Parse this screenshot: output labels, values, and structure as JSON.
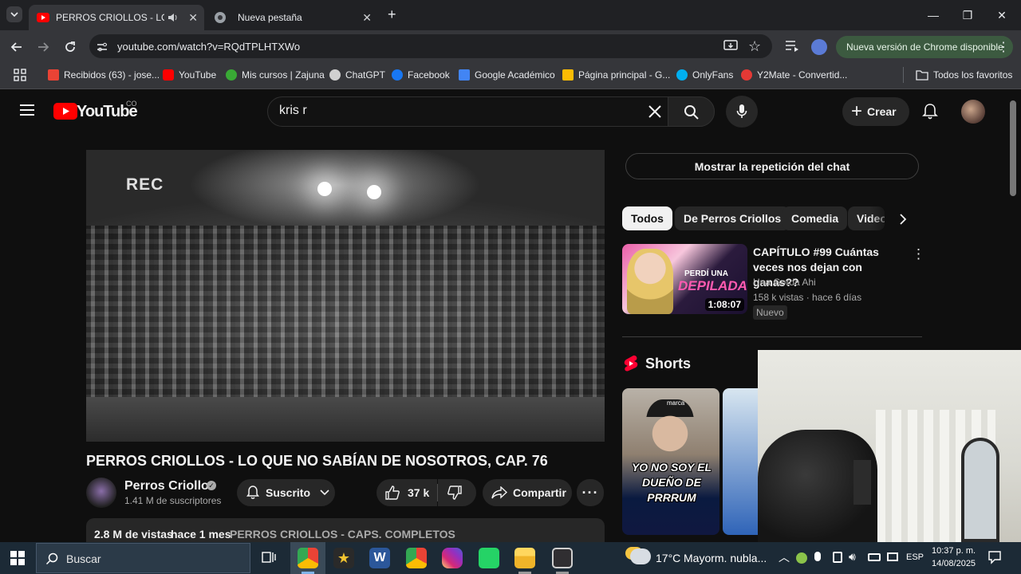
{
  "browser": {
    "tabs": [
      {
        "title": "PERROS CRIOLLOS - LO QU",
        "active": true
      },
      {
        "title": "Nueva pestaña",
        "active": false
      }
    ],
    "new_tab": "+",
    "url": "youtube.com/watch?v=RQdTPLHTXWo",
    "update_label": "Nueva versión de Chrome disponible",
    "bookmarks": [
      {
        "label": "Recibidos (63) - jose...",
        "color": "#ea4335"
      },
      {
        "label": "YouTube",
        "color": "#ff0000"
      },
      {
        "label": "Mis cursos | Zajuna",
        "color": "#39a935"
      },
      {
        "label": "ChatGPT",
        "color": "#d0d0d0"
      },
      {
        "label": "Facebook",
        "color": "#1877f2"
      },
      {
        "label": "Google Académico",
        "color": "#4285f4"
      },
      {
        "label": "Página principal - G...",
        "color": "#fbbc04"
      },
      {
        "label": "OnlyFans",
        "color": "#00aff0"
      },
      {
        "label": "Y2Mate - Convertid...",
        "color": "#e53935"
      }
    ],
    "all_bookmarks": "Todos los favoritos"
  },
  "youtube": {
    "logo_text": "YouTube",
    "country": "CO",
    "search_value": "kris r",
    "create_label": "Crear",
    "video": {
      "overlay": "REC",
      "title": "PERROS CRIOLLOS - LO QUE NO SABÍAN DE NOSOTROS, CAP. 76"
    },
    "channel": {
      "name": "Perros Criollos",
      "subscribers": "1.41 M de suscriptores",
      "subscribed_label": "Suscrito"
    },
    "likes": "37 k",
    "share_label": "Compartir",
    "description": {
      "views": "2.8 M de vistas",
      "date": "hace 1 mes",
      "playlist": "PERROS CRIOLLOS - CAPS. COMPLETOS"
    },
    "chat_replay": "Mostrar la repetición del chat",
    "chips": [
      "Todos",
      "De Perros Criollos",
      "Comedia",
      "Video"
    ],
    "recommendation": {
      "title": "CAPÍTULO #99 Cuántas veces nos dejan con ganas??",
      "channel": "Una Gorda Ahi",
      "meta": "158 k vistas · hace 6 días",
      "badge": "Nuevo",
      "duration": "1:08:07",
      "thumb_text_1": "PERDÍ UNA",
      "thumb_text_2": "DEPILADA"
    },
    "shorts_label": "Shorts",
    "short": {
      "caption": "YO NO SOY EL DUEÑO DE PRRRUM",
      "cap_text": "marca"
    }
  },
  "taskbar": {
    "search_placeholder": "Buscar",
    "weather_temp": "17°C",
    "weather_text": "Mayorm. nubla...",
    "lang": "ESP",
    "time": "10:37 p. m.",
    "date": "14/08/2025"
  }
}
